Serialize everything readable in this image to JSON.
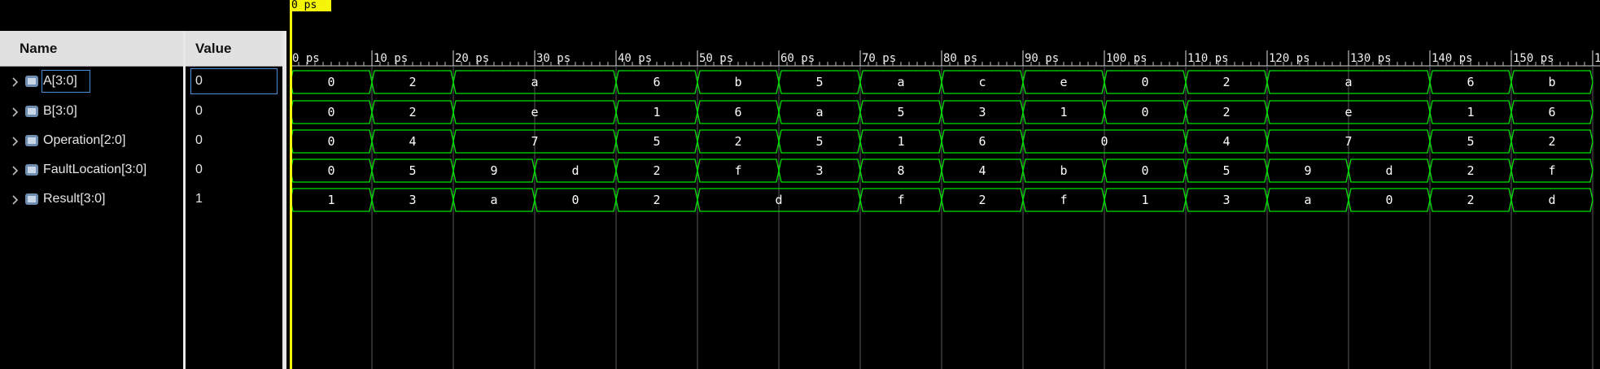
{
  "cursor": {
    "label": "0 ps"
  },
  "headers": {
    "name": "Name",
    "value": "Value"
  },
  "ruler": {
    "unit": "ps",
    "labels": [
      "0 ps",
      "10 ps",
      "20 ps",
      "30 ps",
      "40 ps",
      "50 ps",
      "60 ps",
      "70 ps",
      "80 ps",
      "90 ps",
      "100 ps",
      "110 ps",
      "120 ps",
      "130 ps",
      "140 ps",
      "150 ps",
      "1"
    ]
  },
  "colors": {
    "wave": "#00e000",
    "grid": "#5a5a5a",
    "cursor": "#f5f50a",
    "icon": "#6f8db0"
  },
  "signals": [
    {
      "name": "A[3:0]",
      "value": "0",
      "selected": true,
      "segments": [
        [
          "0",
          0,
          10
        ],
        [
          "2",
          10,
          20
        ],
        [
          "a",
          20,
          40
        ],
        [
          "6",
          40,
          50
        ],
        [
          "b",
          50,
          60
        ],
        [
          "5",
          60,
          70
        ],
        [
          "a",
          70,
          80
        ],
        [
          "c",
          80,
          90
        ],
        [
          "e",
          90,
          100
        ],
        [
          "0",
          100,
          110
        ],
        [
          "2",
          110,
          120
        ],
        [
          "a",
          120,
          140
        ],
        [
          "6",
          140,
          150
        ],
        [
          "b",
          150,
          160
        ]
      ]
    },
    {
      "name": "B[3:0]",
      "value": "0",
      "selected": false,
      "segments": [
        [
          "0",
          0,
          10
        ],
        [
          "2",
          10,
          20
        ],
        [
          "e",
          20,
          40
        ],
        [
          "1",
          40,
          50
        ],
        [
          "6",
          50,
          60
        ],
        [
          "a",
          60,
          70
        ],
        [
          "5",
          70,
          80
        ],
        [
          "3",
          80,
          90
        ],
        [
          "1",
          90,
          100
        ],
        [
          "0",
          100,
          110
        ],
        [
          "2",
          110,
          120
        ],
        [
          "e",
          120,
          140
        ],
        [
          "1",
          140,
          150
        ],
        [
          "6",
          150,
          160
        ]
      ]
    },
    {
      "name": "Operation[2:0]",
      "value": "0",
      "selected": false,
      "segments": [
        [
          "0",
          0,
          10
        ],
        [
          "4",
          10,
          20
        ],
        [
          "7",
          20,
          40
        ],
        [
          "5",
          40,
          50
        ],
        [
          "2",
          50,
          60
        ],
        [
          "5",
          60,
          70
        ],
        [
          "1",
          70,
          80
        ],
        [
          "6",
          80,
          90
        ],
        [
          "0",
          90,
          110
        ],
        [
          "4",
          110,
          120
        ],
        [
          "7",
          120,
          140
        ],
        [
          "5",
          140,
          150
        ],
        [
          "2",
          150,
          160
        ]
      ]
    },
    {
      "name": "FaultLocation[3:0]",
      "value": "0",
      "selected": false,
      "segments": [
        [
          "0",
          0,
          10
        ],
        [
          "5",
          10,
          20
        ],
        [
          "9",
          20,
          30
        ],
        [
          "d",
          30,
          40
        ],
        [
          "2",
          40,
          50
        ],
        [
          "f",
          50,
          60
        ],
        [
          "3",
          60,
          70
        ],
        [
          "8",
          70,
          80
        ],
        [
          "4",
          80,
          90
        ],
        [
          "b",
          90,
          100
        ],
        [
          "0",
          100,
          110
        ],
        [
          "5",
          110,
          120
        ],
        [
          "9",
          120,
          130
        ],
        [
          "d",
          130,
          140
        ],
        [
          "2",
          140,
          150
        ],
        [
          "f",
          150,
          160
        ]
      ]
    },
    {
      "name": "Result[3:0]",
      "value": "1",
      "selected": false,
      "segments": [
        [
          "1",
          0,
          10
        ],
        [
          "3",
          10,
          20
        ],
        [
          "a",
          20,
          30
        ],
        [
          "0",
          30,
          40
        ],
        [
          "2",
          40,
          50
        ],
        [
          "d",
          50,
          70
        ],
        [
          "f",
          70,
          80
        ],
        [
          "2",
          80,
          90
        ],
        [
          "f",
          90,
          100
        ],
        [
          "1",
          100,
          110
        ],
        [
          "3",
          110,
          120
        ],
        [
          "a",
          120,
          130
        ],
        [
          "0",
          130,
          140
        ],
        [
          "2",
          140,
          150
        ],
        [
          "d",
          150,
          160
        ]
      ]
    }
  ]
}
